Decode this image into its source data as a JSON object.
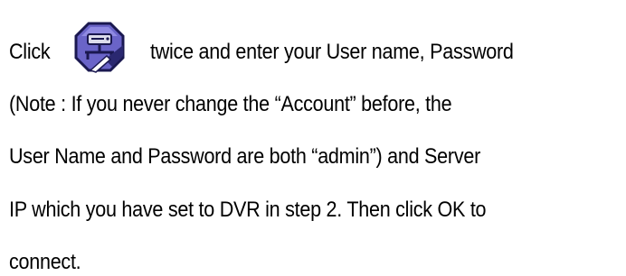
{
  "lines": {
    "l1_a": "Click",
    "l1_b": "twice and enter your User name, Password",
    "l2": "(Note : If you never change the “Account” before, the",
    "l3": "User Name and Password are both “admin”) and Server",
    "l4": "IP which you have set to DVR in step 2. Then click OK to",
    "l5": "connect."
  },
  "icon": {
    "name": "network-connection-icon",
    "colors": {
      "body": "#6a64c8",
      "dark": "#1a1850",
      "highlight": "#d8d4ff"
    }
  }
}
